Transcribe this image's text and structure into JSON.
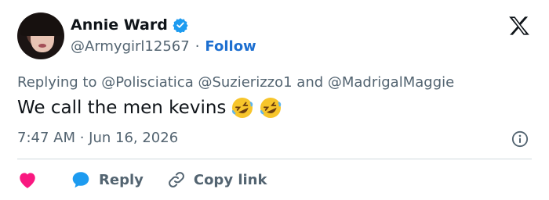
{
  "author": {
    "name": "Annie Ward",
    "handle": "@Armygirl12567",
    "separator": "·",
    "follow_label": "Follow",
    "verified": true,
    "avatar_icon": "profile-photo"
  },
  "tweet": {
    "replying_to": "Replying to @Polisciatica @Suzierizzo1 and @MadrigalMaggie",
    "text": "We call the men kevins",
    "emojis": [
      "rolling-on-floor-laughing",
      "rolling-on-floor-laughing"
    ],
    "timestamp": "7:47 AM · Jun 16, 2026"
  },
  "actions": {
    "like_icon": "heart-icon",
    "reply_label": "Reply",
    "copy_link_label": "Copy link"
  },
  "colors": {
    "accent": "#1d9bf0",
    "follow": "#1d6fd0",
    "like": "#f91880",
    "secondary_text": "#536471",
    "primary_text": "#0f1419"
  }
}
